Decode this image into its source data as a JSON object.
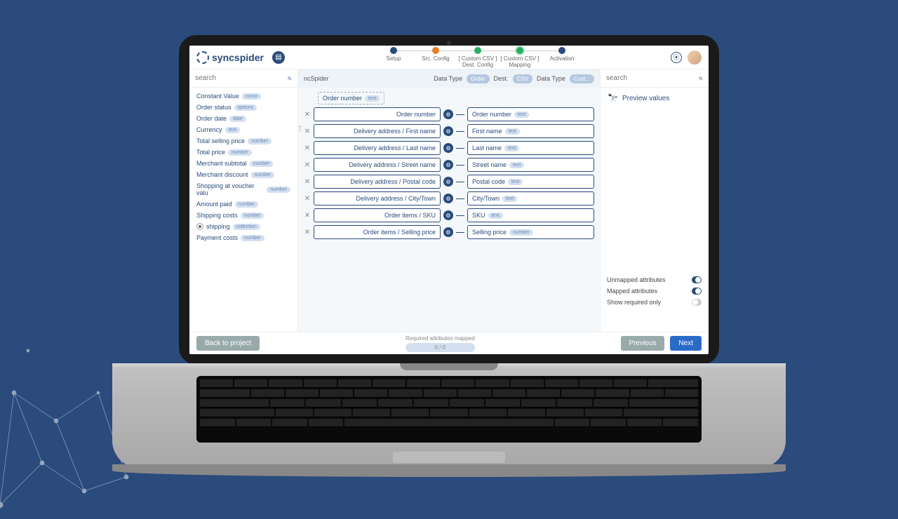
{
  "brand": "syncspider",
  "stepper": [
    {
      "label": "Setup"
    },
    {
      "label": "Src. Config"
    },
    {
      "label": "[ Custom CSV ] Dest. Config"
    },
    {
      "label": "[ Custom CSV ] Mapping"
    },
    {
      "label": "Activation"
    }
  ],
  "leftSearch": {
    "placeholder": "search"
  },
  "rightSearch": {
    "placeholder": "search"
  },
  "centerHead": {
    "src_hint": "ncSpider",
    "dt1_label": "Data Type",
    "dt1_val": "Order",
    "dest_label": "Dest.",
    "dest_val": "CSV",
    "dt2_label": "Data Type",
    "dt2_val": "Cust..."
  },
  "leftAttrs": [
    {
      "name": "Constant Value",
      "type": "const"
    },
    {
      "name": "Order status",
      "type": "options"
    },
    {
      "name": "Order date",
      "type": "date"
    },
    {
      "name": "Currency",
      "type": "text"
    },
    {
      "name": "Total selling price",
      "type": "number"
    },
    {
      "name": "Total price",
      "type": "number"
    },
    {
      "name": "Merchant subtotal",
      "type": "number"
    },
    {
      "name": "Merchant discount",
      "type": "number"
    },
    {
      "name": "Shopping at voucher valu",
      "type": "number"
    },
    {
      "name": "Amount paid",
      "type": "number"
    },
    {
      "name": "Shipping costs",
      "type": "number"
    },
    {
      "name": "shipping",
      "type": "collection",
      "bullet": true
    },
    {
      "name": "Payment costs",
      "type": "number"
    }
  ],
  "ghost": {
    "label": "Order number",
    "type": "text"
  },
  "mappings": [
    {
      "src": "Order number",
      "dst": "Order number",
      "dtype": "text"
    },
    {
      "src": "Delivery address / First name",
      "dst": "First name",
      "dtype": "text"
    },
    {
      "src": "Delivery address / Last name",
      "dst": "Last name",
      "dtype": "text"
    },
    {
      "src": "Delivery address / Street name",
      "dst": "Street name",
      "dtype": "text"
    },
    {
      "src": "Delivery address / Postal code",
      "dst": "Postal code",
      "dtype": "text"
    },
    {
      "src": "Delivery address / City/Town",
      "dst": "City/Town",
      "dtype": "text"
    },
    {
      "src": "Order items / SKU",
      "dst": "SKU",
      "dtype": "text"
    },
    {
      "src": "Order items / Selling price",
      "dst": "Selling price",
      "dtype": "number"
    }
  ],
  "preview": "Preview values",
  "filters": {
    "unmapped": "Unmapped attributes",
    "mapped": "Mapped attributes",
    "required": "Show required only"
  },
  "footer": {
    "back": "Back to project",
    "req_label": "Required attributes mapped",
    "req_count": "0 / 0",
    "prev": "Previous",
    "next": "Next"
  }
}
